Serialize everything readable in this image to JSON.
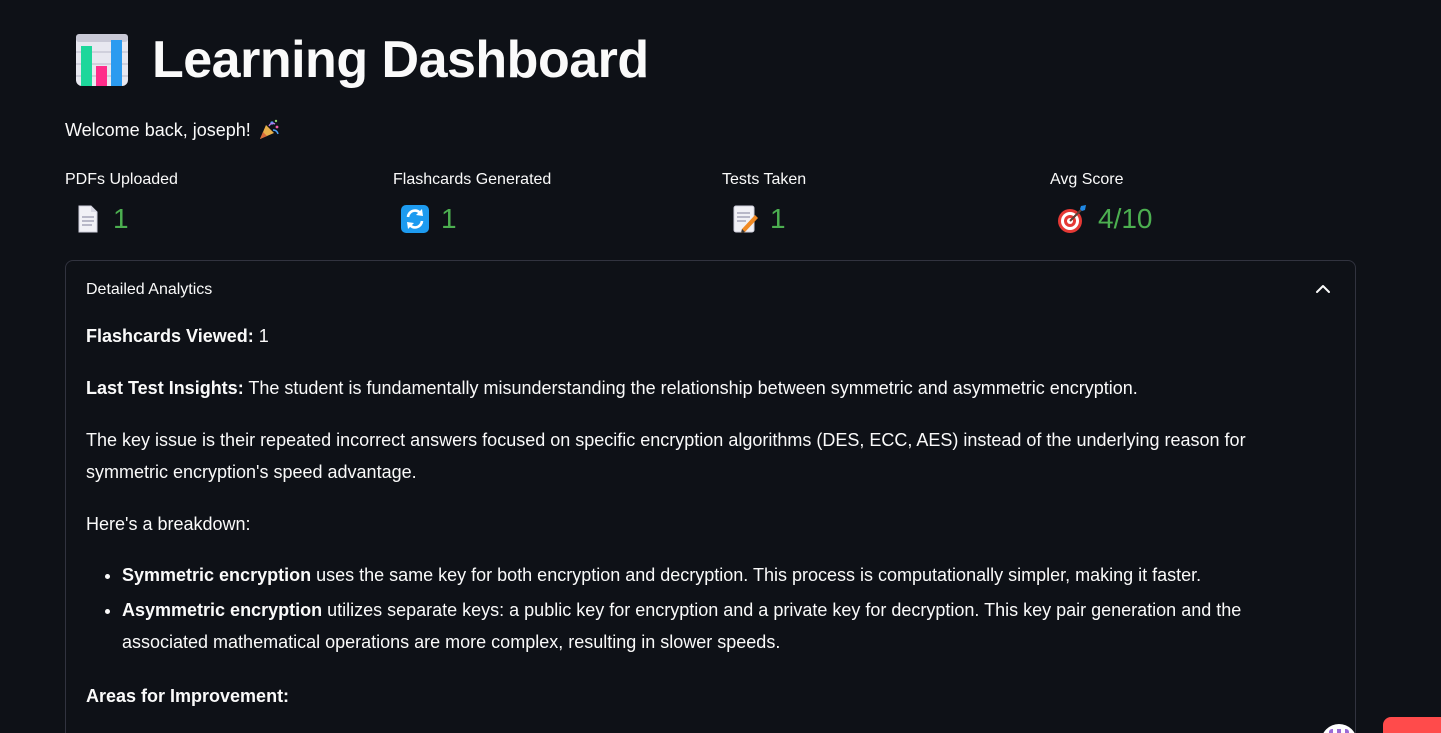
{
  "header": {
    "title": "Learning Dashboard",
    "icon": "bar-chart-icon"
  },
  "welcome": {
    "text": "Welcome back, joseph!",
    "icon": "party-popper-icon"
  },
  "metrics": [
    {
      "label": "PDFs Uploaded",
      "icon": "page-icon",
      "value": "1"
    },
    {
      "label": "Flashcards Generated",
      "icon": "refresh-icon",
      "value": "1"
    },
    {
      "label": "Tests Taken",
      "icon": "memo-icon",
      "value": "1"
    },
    {
      "label": "Avg Score",
      "icon": "target-icon",
      "value": "4/10"
    }
  ],
  "analytics": {
    "header": "Detailed Analytics",
    "flashcards_viewed_label": "Flashcards Viewed:",
    "flashcards_viewed_value": "1",
    "insights_label": "Last Test Insights:",
    "insights_text": "The student is fundamentally misunderstanding the relationship between symmetric and asymmetric encryption.",
    "paragraph_key_issue": "The key issue is their repeated incorrect answers focused on specific encryption algorithms (DES, ECC, AES) instead of the underlying reason for symmetric encryption's speed advantage.",
    "breakdown_intro": "Here's a breakdown:",
    "bullets": [
      {
        "bold": "Symmetric encryption",
        "text": " uses the same key for both encryption and decryption. This process is computationally simpler, making it faster."
      },
      {
        "bold": "Asymmetric encryption",
        "text": " utilizes separate keys: a public key for encryption and a private key for decryption. This key pair generation and the associated mathematical operations are more complex, resulting in slower speeds."
      }
    ],
    "areas_label": "Areas for Improvement:"
  },
  "colors": {
    "background": "#0e1117",
    "text": "#fafafa",
    "metric_value": "#4caf50",
    "border": "#31333f",
    "accent": "#ff4b4b"
  }
}
